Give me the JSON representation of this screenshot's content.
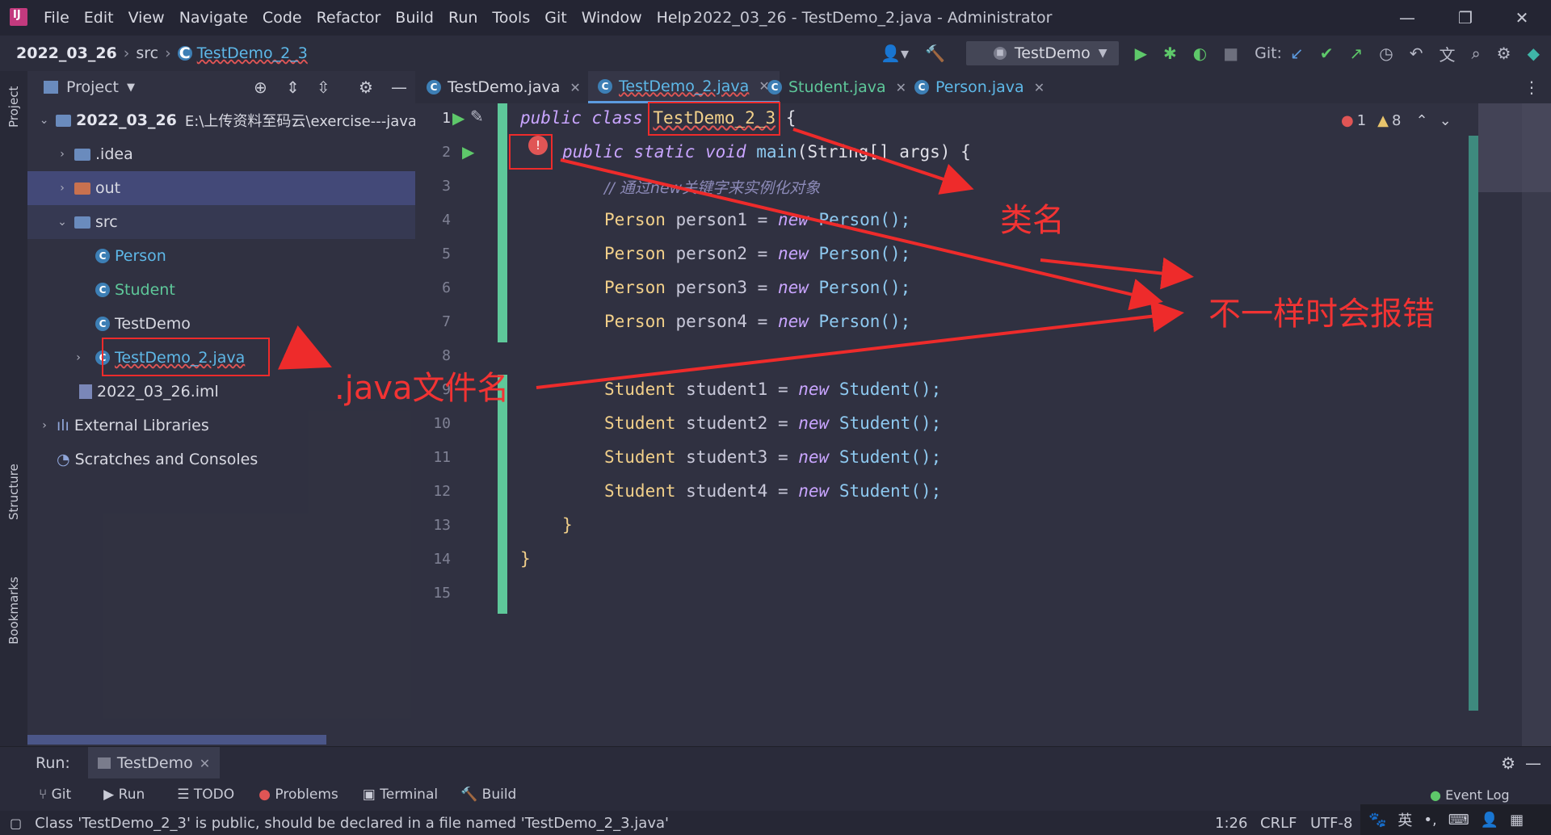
{
  "window": {
    "menus": [
      "File",
      "Edit",
      "View",
      "Navigate",
      "Code",
      "Refactor",
      "Build",
      "Run",
      "Tools",
      "Git",
      "Window",
      "Help"
    ],
    "title": "2022_03_26 - TestDemo_2.java - Administrator",
    "controls": [
      "—",
      "❐",
      "✕"
    ]
  },
  "breadcrumb": {
    "project": "2022_03_26",
    "folder": "src",
    "file": "TestDemo_2_3"
  },
  "toolbar": {
    "run_config": "TestDemo",
    "git_label": "Git:"
  },
  "side_tabs": {
    "project": "Project",
    "structure": "Structure",
    "bookmarks": "Bookmarks"
  },
  "project_panel": {
    "title": "Project",
    "tree": [
      {
        "label": "2022_03_26",
        "extra": "E:\\上传资料至码云\\exercise---java-co"
      },
      {
        "label": ".idea"
      },
      {
        "label": "out"
      },
      {
        "label": "src"
      },
      {
        "label": "Person"
      },
      {
        "label": "Student"
      },
      {
        "label": "TestDemo"
      },
      {
        "label": "TestDemo_2.java"
      },
      {
        "label": "2022_03_26.iml"
      },
      {
        "label": "External Libraries"
      },
      {
        "label": "Scratches and Consoles"
      }
    ]
  },
  "tabs": [
    "TestDemo.java",
    "TestDemo_2.java",
    "Student.java",
    "Person.java"
  ],
  "inspections": {
    "errors": "1",
    "warnings": "8"
  },
  "line_numbers": [
    "1",
    "2",
    "3",
    "4",
    "5",
    "6",
    "7",
    "8",
    "9",
    "10",
    "11",
    "12",
    "13",
    "14",
    "15"
  ],
  "code": {
    "l1": {
      "kw": "public class ",
      "cls": "TestDemo_2_3",
      "brace": " {"
    },
    "l2": {
      "kw": "public static void ",
      "name": "main",
      "args": "(String[] args) {"
    },
    "l3": "// 通过new关键字来实例化对象",
    "persons": [
      {
        "type": "Person",
        "var": " person1 = ",
        "new": "new",
        "ctor": " Person();"
      },
      {
        "type": "Person",
        "var": " person2 = ",
        "new": "new",
        "ctor": " Person();"
      },
      {
        "type": "Person",
        "var": " person3 = ",
        "new": "new",
        "ctor": " Person();"
      },
      {
        "type": "Person",
        "var": " person4 = ",
        "new": "new",
        "ctor": " Person();"
      }
    ],
    "students": [
      {
        "type": "Student",
        "var": " student1 = ",
        "new": "new",
        "ctor": " Student();"
      },
      {
        "type": "Student",
        "var": " student2 = ",
        "new": "new",
        "ctor": " Student();"
      },
      {
        "type": "Student",
        "var": " student3 = ",
        "new": "new",
        "ctor": " Student();"
      },
      {
        "type": "Student",
        "var": " student4 = ",
        "new": "new",
        "ctor": " Student();"
      }
    ],
    "l13": "}",
    "l14": "}"
  },
  "annotations": {
    "classname": "类名",
    "filename": ".java文件名",
    "error_note": "不一样时会报错"
  },
  "runbar": {
    "label": "Run:",
    "tab": "TestDemo"
  },
  "tool_windows": [
    "Git",
    "Run",
    "TODO",
    "Problems",
    "Terminal",
    "Build"
  ],
  "event_log": "Event Log",
  "status": {
    "message": "Class 'TestDemo_2_3' is public, should be declared in a file named 'TestDemo_2_3.java'",
    "position": "1:26",
    "line_sep": "CRLF",
    "encoding": "UTF-8",
    "ime": "英"
  },
  "colors": {
    "accent": "#5c9be0",
    "error": "#ee2b2b",
    "change_bar": "#5ec89a"
  }
}
